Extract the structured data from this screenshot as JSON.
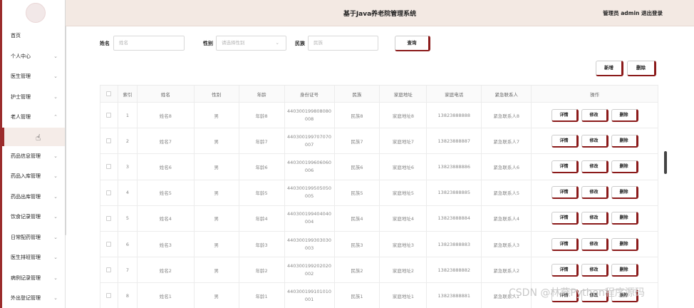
{
  "header": {
    "title": "基于Java养老院管理系统",
    "admin": "管理员 admin  退出登录"
  },
  "sidebar": {
    "items": [
      {
        "label": "首页",
        "chev": ""
      },
      {
        "label": "个人中心",
        "chev": "⌄"
      },
      {
        "label": "医生管理",
        "chev": "⌄"
      },
      {
        "label": "护士管理",
        "chev": "⌄"
      },
      {
        "label": "老人管理",
        "chev": "⌃"
      }
    ],
    "items2": [
      {
        "label": "药品信息管理",
        "chev": "⌄"
      },
      {
        "label": "药品入库管理",
        "chev": "⌄"
      },
      {
        "label": "药品出库管理",
        "chev": "⌄"
      },
      {
        "label": "饮食记录管理",
        "chev": "⌄"
      },
      {
        "label": "日常配药管理",
        "chev": "⌄"
      },
      {
        "label": "医生排班管理",
        "chev": "⌄"
      },
      {
        "label": "病例记录管理",
        "chev": "⌄"
      },
      {
        "label": "外出登记管理",
        "chev": "⌄"
      }
    ]
  },
  "search": {
    "name_label": "姓名",
    "name_placeholder": "姓名",
    "gender_label": "性别",
    "gender_placeholder": "请选择性别",
    "nation_label": "民族",
    "nation_placeholder": "民族",
    "query_button": "查询"
  },
  "toolbar": {
    "add": "新增",
    "delete": "删除"
  },
  "table": {
    "headers": [
      "",
      "索引",
      "姓名",
      "性别",
      "年龄",
      "身份证号",
      "民族",
      "家庭地址",
      "家庭电话",
      "紧急联系人",
      "操作"
    ],
    "actions": [
      "详情",
      "修改",
      "删除"
    ],
    "rows": [
      {
        "idx": "1",
        "name": "姓名8",
        "gender": "男",
        "age": "年龄8",
        "id1": "440300199808080",
        "id2": "008",
        "nation": "民族8",
        "addr": "家庭地址8",
        "phone": "13823888888",
        "contact": "紧急联系人8"
      },
      {
        "idx": "2",
        "name": "姓名7",
        "gender": "男",
        "age": "年龄7",
        "id1": "440300199707070",
        "id2": "007",
        "nation": "民族7",
        "addr": "家庭地址7",
        "phone": "13823888887",
        "contact": "紧急联系人7"
      },
      {
        "idx": "3",
        "name": "姓名6",
        "gender": "男",
        "age": "年龄6",
        "id1": "440300199606060",
        "id2": "006",
        "nation": "民族6",
        "addr": "家庭地址6",
        "phone": "13823888886",
        "contact": "紧急联系人6"
      },
      {
        "idx": "4",
        "name": "姓名5",
        "gender": "男",
        "age": "年龄5",
        "id1": "440300199505050",
        "id2": "005",
        "nation": "民族5",
        "addr": "家庭地址5",
        "phone": "13823888885",
        "contact": "紧急联系人5"
      },
      {
        "idx": "5",
        "name": "姓名4",
        "gender": "男",
        "age": "年龄4",
        "id1": "440300199404040",
        "id2": "004",
        "nation": "民族4",
        "addr": "家庭地址4",
        "phone": "13823888884",
        "contact": "紧急联系人4"
      },
      {
        "idx": "6",
        "name": "姓名3",
        "gender": "男",
        "age": "年龄3",
        "id1": "440300199303030",
        "id2": "003",
        "nation": "民族3",
        "addr": "家庭地址3",
        "phone": "13823888883",
        "contact": "紧急联系人3"
      },
      {
        "idx": "7",
        "name": "姓名2",
        "gender": "男",
        "age": "年龄2",
        "id1": "440300199202020",
        "id2": "002",
        "nation": "民族2",
        "addr": "家庭地址2",
        "phone": "13823888882",
        "contact": "紧急联系人2"
      },
      {
        "idx": "8",
        "name": "姓名1",
        "gender": "男",
        "age": "年龄1",
        "id1": "440300199101010",
        "id2": "001",
        "nation": "民族1",
        "addr": "家庭地址1",
        "phone": "13823888881",
        "contact": "紧急联系人1"
      }
    ]
  },
  "watermark": "CSDN @林燕Python程序源码",
  "colors": {
    "accent": "#8b1a1a",
    "header_bg": "#f3e9e3"
  }
}
